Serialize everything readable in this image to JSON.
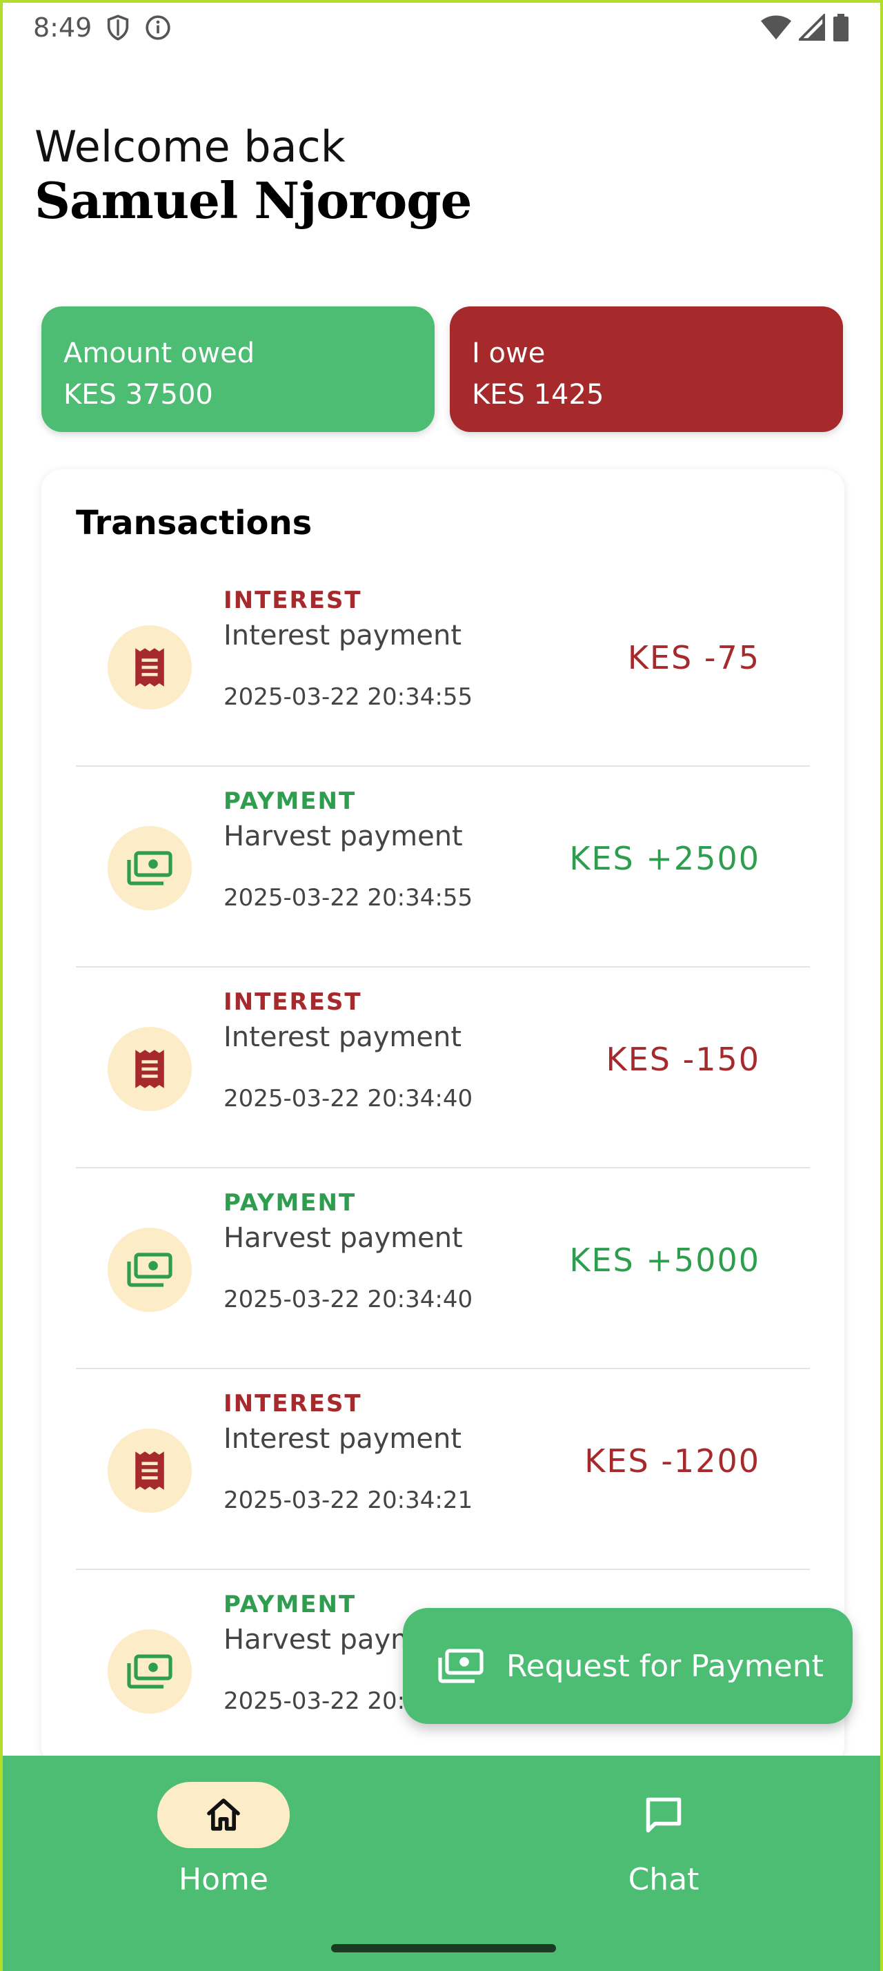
{
  "status_bar": {
    "time": "8:49",
    "icons": [
      "shield-icon",
      "info-icon",
      "wifi-icon",
      "signal-icon",
      "battery-icon"
    ]
  },
  "header": {
    "greeting": "Welcome back",
    "user_name": "Samuel Njoroge"
  },
  "summary": {
    "owed": {
      "label": "Amount owed",
      "value": "KES 37500",
      "color": "#4cbd73"
    },
    "iowe": {
      "label": "I owe",
      "value": "KES 1425",
      "color": "#a6292c"
    }
  },
  "transactions": {
    "title": "Transactions",
    "items": [
      {
        "type": "INTEREST",
        "description": "Interest payment",
        "date": "2025-03-22 20:34:55",
        "amount": "KES -75",
        "icon": "receipt-icon"
      },
      {
        "type": "PAYMENT",
        "description": "Harvest payment",
        "date": "2025-03-22 20:34:55",
        "amount": "KES +2500",
        "icon": "money-icon"
      },
      {
        "type": "INTEREST",
        "description": "Interest payment",
        "date": "2025-03-22 20:34:40",
        "amount": "KES -150",
        "icon": "receipt-icon"
      },
      {
        "type": "PAYMENT",
        "description": "Harvest payment",
        "date": "2025-03-22 20:34:40",
        "amount": "KES +5000",
        "icon": "money-icon"
      },
      {
        "type": "INTEREST",
        "description": "Interest payment",
        "date": "2025-03-22 20:34:21",
        "amount": "KES -1200",
        "icon": "receipt-icon"
      },
      {
        "type": "PAYMENT",
        "description": "Harvest payment",
        "date": "2025-03-22 20:34:21",
        "amount": "",
        "icon": "money-icon"
      }
    ]
  },
  "fab": {
    "label": "Request for Payment",
    "icon": "money-icon"
  },
  "bottom_nav": {
    "home": {
      "label": "Home",
      "icon": "home-icon",
      "selected": true
    },
    "chat": {
      "label": "Chat",
      "icon": "chat-icon"
    }
  },
  "colors": {
    "brand_green": "#4cbd73",
    "brand_red": "#a6292c",
    "icon_bg": "#fcecc8"
  }
}
